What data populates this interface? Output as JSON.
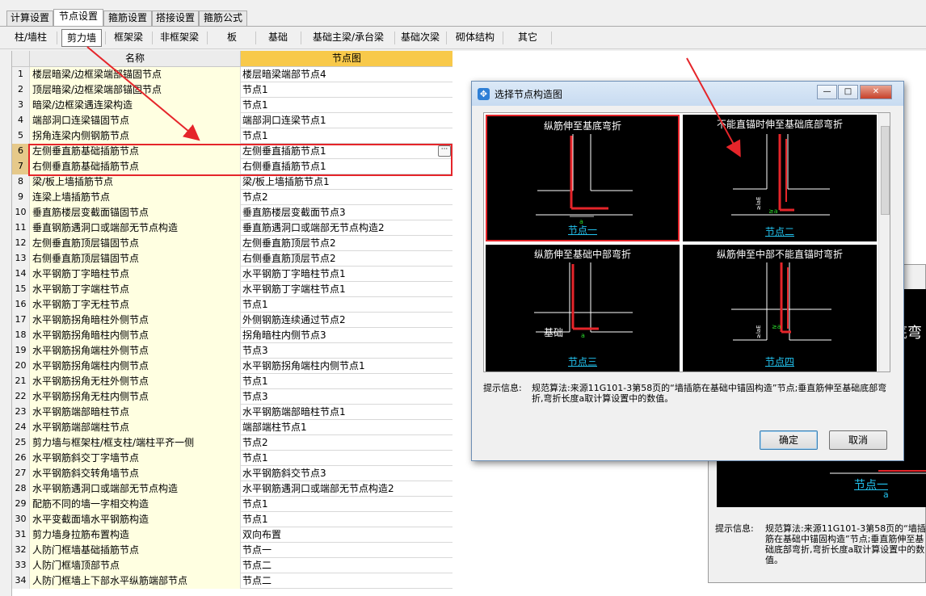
{
  "tabs": [
    "计算设置",
    "节点设置",
    "箍筋设置",
    "搭接设置",
    "箍筋公式"
  ],
  "active_tab": 1,
  "subtabs": [
    "柱/墙柱",
    "剪力墙",
    "框架梁",
    "非框架梁",
    "板",
    "基础",
    "基础主梁/承台梁",
    "基础次梁",
    "砌体结构",
    "其它"
  ],
  "active_subtab": 1,
  "grid": {
    "col_name": "名称",
    "col_node": "节点图",
    "ellipsis": "···",
    "rows": [
      {
        "no": "1",
        "name": "楼层暗梁/边框梁端部锚固节点",
        "node": "楼层暗梁端部节点4"
      },
      {
        "no": "2",
        "name": "顶层暗梁/边框梁端部锚固节点",
        "node": "节点1"
      },
      {
        "no": "3",
        "name": "暗梁/边框梁遇连梁构造",
        "node": "节点1"
      },
      {
        "no": "4",
        "name": "端部洞口连梁锚固节点",
        "node": "端部洞口连梁节点1"
      },
      {
        "no": "5",
        "name": "拐角连梁内侧钢筋节点",
        "node": "节点1"
      },
      {
        "no": "6",
        "name": "左侧垂直筋基础插筋节点",
        "node": "左侧垂直插筋节点1"
      },
      {
        "no": "7",
        "name": "右侧垂直筋基础插筋节点",
        "node": "右侧垂直插筋节点1"
      },
      {
        "no": "8",
        "name": "梁/板上墙插筋节点",
        "node": "梁/板上墙插筋节点1"
      },
      {
        "no": "9",
        "name": "连梁上墙插筋节点",
        "node": "节点2"
      },
      {
        "no": "10",
        "name": "垂直筋楼层变截面锚固节点",
        "node": "垂直筋楼层变截面节点3"
      },
      {
        "no": "11",
        "name": "垂直钢筋遇洞口或端部无节点构造",
        "node": "垂直筋遇洞口或端部无节点构造2"
      },
      {
        "no": "12",
        "name": "左侧垂直筋顶层锚固节点",
        "node": "左侧垂直筋顶层节点2"
      },
      {
        "no": "13",
        "name": "右侧垂直筋顶层锚固节点",
        "node": "右侧垂直筋顶层节点2"
      },
      {
        "no": "14",
        "name": "水平钢筋丁字暗柱节点",
        "node": "水平钢筋丁字暗柱节点1"
      },
      {
        "no": "15",
        "name": "水平钢筋丁字端柱节点",
        "node": "水平钢筋丁字端柱节点1"
      },
      {
        "no": "16",
        "name": "水平钢筋丁字无柱节点",
        "node": "节点1"
      },
      {
        "no": "17",
        "name": "水平钢筋拐角暗柱外侧节点",
        "node": "外侧钢筋连续通过节点2"
      },
      {
        "no": "18",
        "name": "水平钢筋拐角暗柱内侧节点",
        "node": "拐角暗柱内侧节点3"
      },
      {
        "no": "19",
        "name": "水平钢筋拐角端柱外侧节点",
        "node": "节点3"
      },
      {
        "no": "20",
        "name": "水平钢筋拐角端柱内侧节点",
        "node": "水平钢筋拐角端柱内侧节点1"
      },
      {
        "no": "21",
        "name": "水平钢筋拐角无柱外侧节点",
        "node": "节点1"
      },
      {
        "no": "22",
        "name": "水平钢筋拐角无柱内侧节点",
        "node": "节点3"
      },
      {
        "no": "23",
        "name": "水平钢筋端部暗柱节点",
        "node": "水平钢筋端部暗柱节点1"
      },
      {
        "no": "24",
        "name": "水平钢筋端部端柱节点",
        "node": "端部端柱节点1"
      },
      {
        "no": "25",
        "name": "剪力墙与框架柱/框支柱/端柱平齐一侧",
        "node": "节点2"
      },
      {
        "no": "26",
        "name": "水平钢筋斜交丁字墙节点",
        "node": "节点1"
      },
      {
        "no": "27",
        "name": "水平钢筋斜交转角墙节点",
        "node": "水平钢筋斜交节点3"
      },
      {
        "no": "28",
        "name": "水平钢筋遇洞口或端部无节点构造",
        "node": "水平钢筋遇洞口或端部无节点构造2"
      },
      {
        "no": "29",
        "name": "配筋不同的墙一字相交构造",
        "node": "节点1"
      },
      {
        "no": "30",
        "name": "水平变截面墙水平钢筋构造",
        "node": "节点1"
      },
      {
        "no": "31",
        "name": "剪力墙身拉筋布置构造",
        "node": "双向布置"
      },
      {
        "no": "32",
        "name": "人防门框墙基础插筋节点",
        "node": "节点一"
      },
      {
        "no": "33",
        "name": "人防门框墙顶部节点",
        "node": "节点二"
      },
      {
        "no": "34",
        "name": "人防门框墙上下部水平纵筋端部节点",
        "node": "节点二"
      }
    ]
  },
  "bg_panel": {
    "partial_title": "底弯",
    "a_label": "a",
    "node_label": "节点一",
    "hint_label": "提示信息:",
    "hint_text": "规范算法:来源11G101-3第58页的“墙插筋在基础中锚固构造”节点;垂直筋伸至基础底部弯折,弯折长度a取计算设置中的数值。"
  },
  "dialog": {
    "title": "选择节点构造图",
    "app_icon": "✥",
    "window_buttons": {
      "minimize": "—",
      "maximize": "□",
      "close": "✕"
    },
    "thumbnails": [
      {
        "title": "纵筋伸至基底弯折",
        "label": "节点一",
        "selected": true
      },
      {
        "title": "不能直锚时伸至基础底部弯折",
        "label": "节点二",
        "selected": false
      },
      {
        "title": "纵筋伸至基础中部弯折",
        "label": "节点三",
        "selected": false,
        "extra": "基础"
      },
      {
        "title": "纵筋伸至中部不能直锚时弯折",
        "label": "节点四",
        "selected": false
      }
    ],
    "dim_a": "a",
    "dim_ge_a": "≥a",
    "dim_lae": "≥laE",
    "hint_label": "提示信息:",
    "hint_text": "规范算法:来源11G101-3第58页的“墙插筋在基础中锚固构造”节点;垂直筋伸至基础底部弯折,弯折长度a取计算设置中的数值。",
    "ok": "确定",
    "cancel": "取消"
  },
  "colors": {
    "highlight": "#e5252a",
    "node_link": "#22c2ee",
    "name_col": "#ffffe1",
    "header_node": "#f8c94a"
  }
}
